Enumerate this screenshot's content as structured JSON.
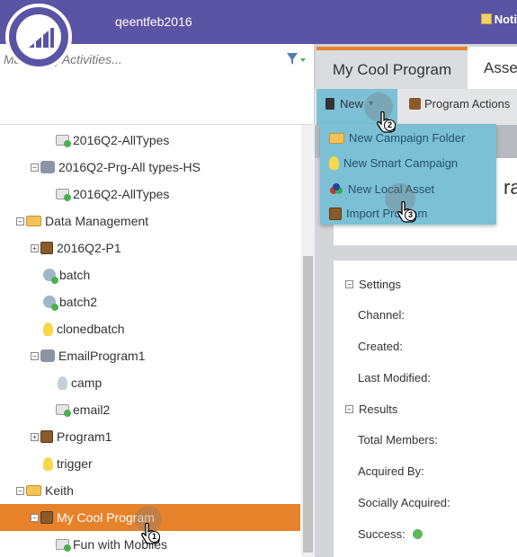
{
  "header": {
    "workspace": "qeentfeb2016",
    "notifications_label": "Noti"
  },
  "search": {
    "placeholder": "Marketing Activities..."
  },
  "tree": [
    {
      "label": "2016Q2-AllTypes",
      "icon": "email-icon"
    },
    {
      "label": "2016Q2-Prg-All types-HS",
      "icon": "program-icon",
      "expander": "−"
    },
    {
      "label": "2016Q2-AllTypes",
      "icon": "email-icon"
    },
    {
      "label": "Data Management",
      "icon": "folder-icon",
      "expander": "−"
    },
    {
      "label": "2016Q2-P1",
      "icon": "program-icon",
      "expander": "+"
    },
    {
      "label": "batch",
      "icon": "campaign-icon"
    },
    {
      "label": "batch2",
      "icon": "campaign-icon"
    },
    {
      "label": "clonedbatch",
      "icon": "bulb-icon"
    },
    {
      "label": "EmailProgram1",
      "icon": "program-icon",
      "expander": "−"
    },
    {
      "label": "camp",
      "icon": "bulb-icon"
    },
    {
      "label": "email2",
      "icon": "email-icon"
    },
    {
      "label": "Program1",
      "icon": "program-icon",
      "expander": "+"
    },
    {
      "label": "trigger",
      "icon": "bulb-icon"
    },
    {
      "label": "Keith",
      "icon": "folder-icon",
      "expander": "−"
    },
    {
      "label": "My Cool Program",
      "icon": "program-icon",
      "expander": "−",
      "selected": true
    },
    {
      "label": "Fun with Mobiles",
      "icon": "email-icon"
    }
  ],
  "tabs": {
    "active": "My Cool Program",
    "inactive": "Asse"
  },
  "toolbar": {
    "new_label": "New",
    "actions_label": "Program Actions"
  },
  "new_menu": [
    {
      "label": "New Campaign Folder",
      "icon": "folder-icon"
    },
    {
      "label": "New Smart Campaign",
      "icon": "bulb-icon"
    },
    {
      "label": "New Local Asset",
      "icon": "asset-icon"
    },
    {
      "label": "Import Program",
      "icon": "import-icon"
    }
  ],
  "card_title": "ram",
  "details": {
    "settings_header": "Settings",
    "channel": "Channel:",
    "created": "Created:",
    "last_modified": "Last Modified:",
    "results_header": "Results",
    "total_members": "Total Members:",
    "acquired_by": "Acquired By:",
    "socially_acquired": "Socially Acquired:",
    "success": "Success:"
  },
  "cursor_steps": [
    "1",
    "2",
    "3"
  ],
  "colors": {
    "brand": "#5a54a4",
    "accent": "#e8822a",
    "menu": "#7cc0d6"
  }
}
